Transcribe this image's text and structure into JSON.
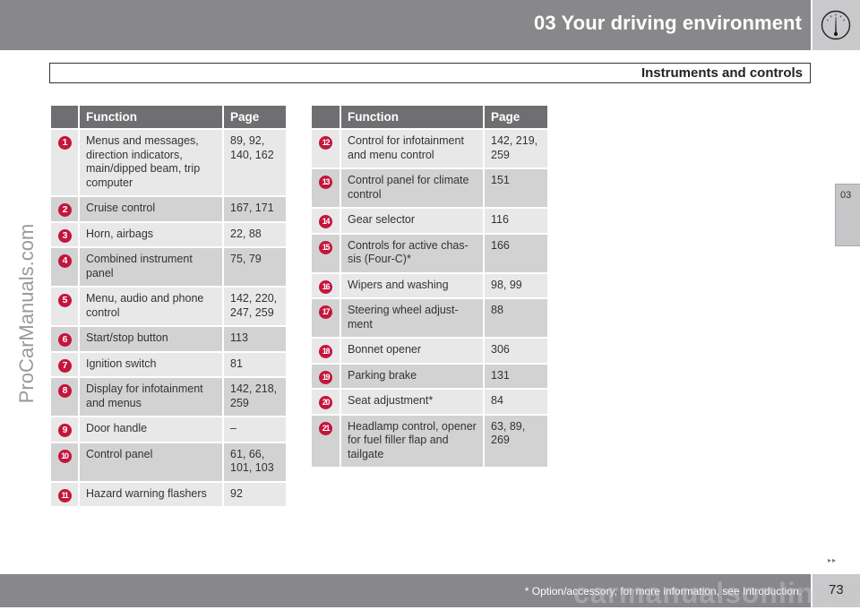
{
  "header": {
    "title": "03 Your driving environment",
    "icon": "speedometer-gauge-icon"
  },
  "subtitle": "Instruments and controls",
  "side_tab": {
    "label": "03"
  },
  "watermarks": {
    "left": "ProCarManuals.com",
    "bottom": "carmanualsonline.info"
  },
  "tables": {
    "left": {
      "headers": {
        "number": "",
        "function": "Function",
        "page": "Page"
      },
      "rows": [
        {
          "num": "1",
          "function": "Menus and messages, direction indicators, main/dipped beam, trip computer",
          "page": "89, 92, 140, 162"
        },
        {
          "num": "2",
          "function": "Cruise control",
          "page": "167, 171"
        },
        {
          "num": "3",
          "function": "Horn, airbags",
          "page": "22, 88"
        },
        {
          "num": "4",
          "function": "Combined instrument panel",
          "page": "75, 79"
        },
        {
          "num": "5",
          "function": "Menu, audio and phone control",
          "page": "142, 220, 247, 259"
        },
        {
          "num": "6",
          "function": "Start/stop button",
          "page": "113"
        },
        {
          "num": "7",
          "function": "Ignition switch",
          "page": "81"
        },
        {
          "num": "8",
          "function": "Display for infotainment and menus",
          "page": "142, 218, 259"
        },
        {
          "num": "9",
          "function": "Door handle",
          "page": "–"
        },
        {
          "num": "10",
          "function": "Control panel",
          "page": "61, 66, 101, 103"
        },
        {
          "num": "11",
          "function": "Hazard warning flashers",
          "page": "92"
        }
      ]
    },
    "right": {
      "headers": {
        "number": "",
        "function": "Function",
        "page": "Page"
      },
      "rows": [
        {
          "num": "12",
          "function": "Control for infotainment and menu control",
          "page": "142, 219, 259"
        },
        {
          "num": "13",
          "function": "Control panel for climate control",
          "page": "151"
        },
        {
          "num": "14",
          "function": "Gear selector",
          "page": "116"
        },
        {
          "num": "15",
          "function": "Controls for active chas-sis (Four-C)*",
          "page": "166"
        },
        {
          "num": "16",
          "function": "Wipers and washing",
          "page": "98, 99"
        },
        {
          "num": "17",
          "function": "Steering wheel adjust-ment",
          "page": "88"
        },
        {
          "num": "18",
          "function": "Bonnet opener",
          "page": "306"
        },
        {
          "num": "19",
          "function": "Parking brake",
          "page": "131"
        },
        {
          "num": "20",
          "function": "Seat adjustment*",
          "page": "84"
        },
        {
          "num": "21",
          "function": "Headlamp control, opener for fuel filler flap and tailgate",
          "page": "63, 89, 269"
        }
      ]
    }
  },
  "footer": {
    "continue_marker": "▸▸",
    "note": "* Option/accessory, for more information, see Introduction.",
    "page_number": "73"
  },
  "colors": {
    "header_bar": "#88888b",
    "icon_box": "#c9c9cb",
    "table_header": "#6f6f72",
    "row_light": "#e8e8e9",
    "row_dark": "#d2d2d3",
    "badge": "#c4153c"
  }
}
